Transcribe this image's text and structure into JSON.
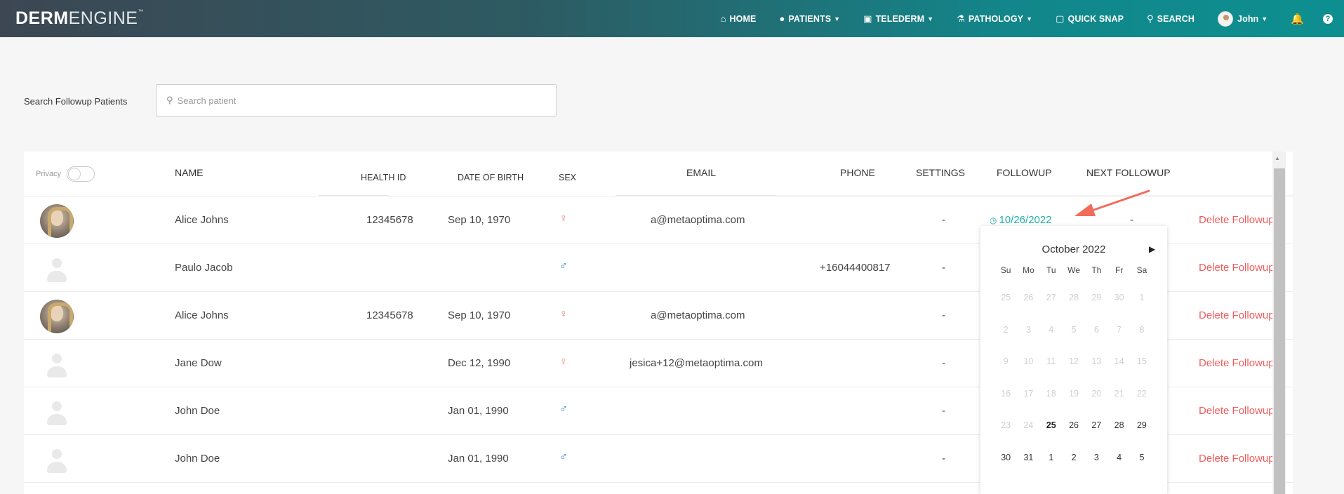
{
  "app": {
    "logo_bold": "DERM",
    "logo_light": "ENGINE",
    "logo_tm": "™"
  },
  "nav": {
    "home": "HOME",
    "patients": "PATIENTS",
    "teleder": "TELEDERM",
    "pathology": "PATHOLOGY",
    "quick_snap": "QUICK SNAP",
    "search": "SEARCH",
    "user": "John",
    "help": "?"
  },
  "search": {
    "label": "Search Followup Patients",
    "placeholder": "Search patient",
    "value": ""
  },
  "table": {
    "privacy_label": "Privacy",
    "headers": {
      "name": "NAME",
      "health_id": "HEALTH ID",
      "dob": "DATE OF BIRTH",
      "sex": "SEX",
      "email": "EMAIL",
      "phone": "PHONE",
      "settings": "SETTINGS",
      "followup": "FOLLOWUP",
      "next_followup": "NEXT FOLLOWUP"
    },
    "rows": [
      {
        "name": "Alice Johns",
        "health_id": "12345678",
        "dob": "Sep 10, 1970",
        "email": "a@metaoptima.com",
        "phone": "",
        "settings": "-",
        "followup": "10/26/2022",
        "next": "-",
        "action": "Delete Followup"
      },
      {
        "name": "Paulo Jacob",
        "health_id": "",
        "dob": "",
        "email": "",
        "phone": "+16044400817",
        "settings": "-",
        "followup": "",
        "next": "",
        "action": "Delete Followup"
      },
      {
        "name": "Alice Johns",
        "health_id": "12345678",
        "dob": "Sep 10, 1970",
        "email": "a@metaoptima.com",
        "phone": "",
        "settings": "-",
        "followup": "",
        "next": "",
        "action": "Delete Followup"
      },
      {
        "name": "Jane Dow",
        "health_id": "",
        "dob": "Dec 12, 1990",
        "email": "jesica+12@metaoptima.com",
        "phone": "",
        "settings": "-",
        "followup": "",
        "next": "",
        "action": "Delete Followup"
      },
      {
        "name": "John Doe",
        "health_id": "",
        "dob": "Jan 01, 1990",
        "email": "",
        "phone": "",
        "settings": "-",
        "followup": "",
        "next": "",
        "action": "Delete Followup"
      },
      {
        "name": "John Doe",
        "health_id": "",
        "dob": "Jan 01, 1990",
        "email": "",
        "phone": "",
        "settings": "-",
        "followup": "",
        "next": "",
        "action": "Delete Followup"
      }
    ]
  },
  "calendar": {
    "month": "October 2022",
    "next": "▶",
    "dow": [
      "Su",
      "Mo",
      "Tu",
      "We",
      "Th",
      "Fr",
      "Sa"
    ],
    "days": [
      "25",
      "26",
      "27",
      "28",
      "29",
      "30",
      "1",
      "2",
      "3",
      "4",
      "5",
      "6",
      "7",
      "8",
      "9",
      "10",
      "11",
      "12",
      "13",
      "14",
      "15",
      "16",
      "17",
      "18",
      "19",
      "20",
      "21",
      "22",
      "23",
      "24",
      "25",
      "26",
      "27",
      "28",
      "29",
      "30",
      "31",
      "1",
      "2",
      "3",
      "4",
      "5"
    ]
  },
  "colors": {
    "accent": "#20b0a8",
    "danger": "#f25c5c",
    "female": "#f08080",
    "male": "#2f7fd8",
    "annotation": "#f26b5b"
  }
}
